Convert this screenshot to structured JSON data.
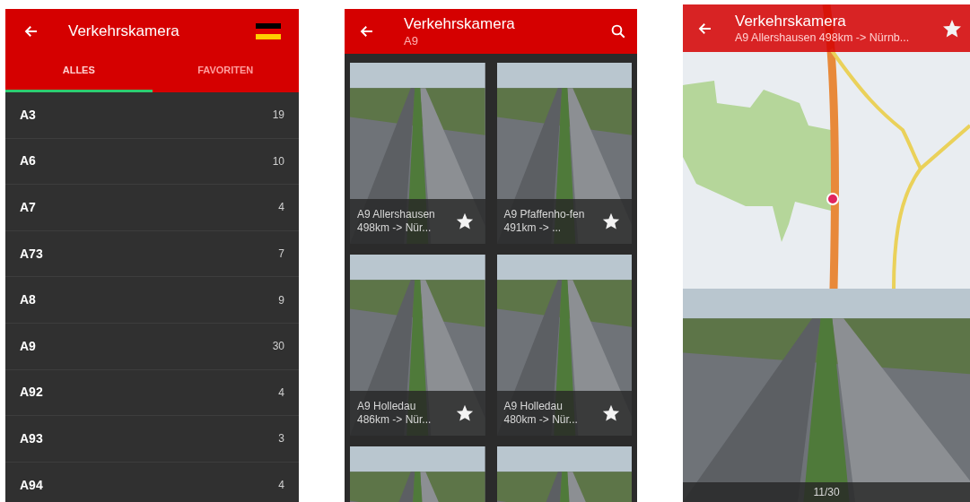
{
  "screens": [
    {
      "kind": "list",
      "title": "Verkehrskamera",
      "tabs": [
        {
          "label": "ALLES",
          "selected": true
        },
        {
          "label": "FAVORITEN",
          "selected": false
        }
      ],
      "roads": [
        {
          "name": "A3",
          "count": "19"
        },
        {
          "name": "A6",
          "count": "10"
        },
        {
          "name": "A7",
          "count": "4"
        },
        {
          "name": "A73",
          "count": "7"
        },
        {
          "name": "A8",
          "count": "9"
        },
        {
          "name": "A9",
          "count": "30"
        },
        {
          "name": "A92",
          "count": "4"
        },
        {
          "name": "A93",
          "count": "3"
        },
        {
          "name": "A94",
          "count": "4"
        }
      ]
    },
    {
      "kind": "grid",
      "title": "Verkehrskamera",
      "subtitle": "A9",
      "tiles": [
        {
          "kind": "captioned",
          "caption": "A9 Allershausen 498km -> Nür...",
          "favorite": false
        },
        {
          "kind": "captioned",
          "caption": "A9 Pfaffenho-fen 491km -> ...",
          "favorite": false
        },
        {
          "kind": "captioned",
          "caption": "A9 Holledau 486km -> Nür...",
          "favorite": false
        },
        {
          "kind": "captioned",
          "caption": "A9 Holledau 480km -> Nür...",
          "favorite": false
        },
        {
          "kind": "photo"
        },
        {
          "kind": "photo"
        }
      ]
    },
    {
      "kind": "detail",
      "title": "Verkehrskamera",
      "subtitle": "A9 Allershausen 498km -> Nürnb...",
      "favorite": false,
      "position": "11/30"
    }
  ]
}
